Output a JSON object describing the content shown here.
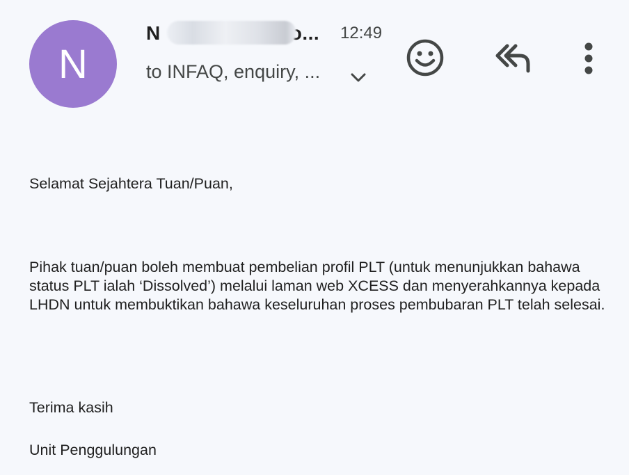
{
  "header": {
    "avatar_letter": "N",
    "avatar_color": "#9a7ad0",
    "sender_visible_start": "N",
    "sender_visible_end": "o...",
    "time": "12:49",
    "recipients": "to INFAQ, enquiry, ...",
    "icons": {
      "expand": "chevron-down-icon",
      "emoji": "emoji-reaction-icon",
      "reply_all": "reply-all-icon",
      "more": "more-vert-icon"
    }
  },
  "message": {
    "greeting": "Selamat Sejahtera Tuan/Puan,",
    "paragraph": "Pihak tuan/puan boleh membuat pembelian profil PLT (untuk menunjukkan bahawa status PLT ialah ‘Dissolved’) melalui laman web XCESS dan menyerahkannya kepada LHDN untuk membuktikan bahawa keseluruhan proses pembubaran PLT telah selesai.",
    "closing": "Terima kasih",
    "signature": "Unit Penggulungan"
  }
}
